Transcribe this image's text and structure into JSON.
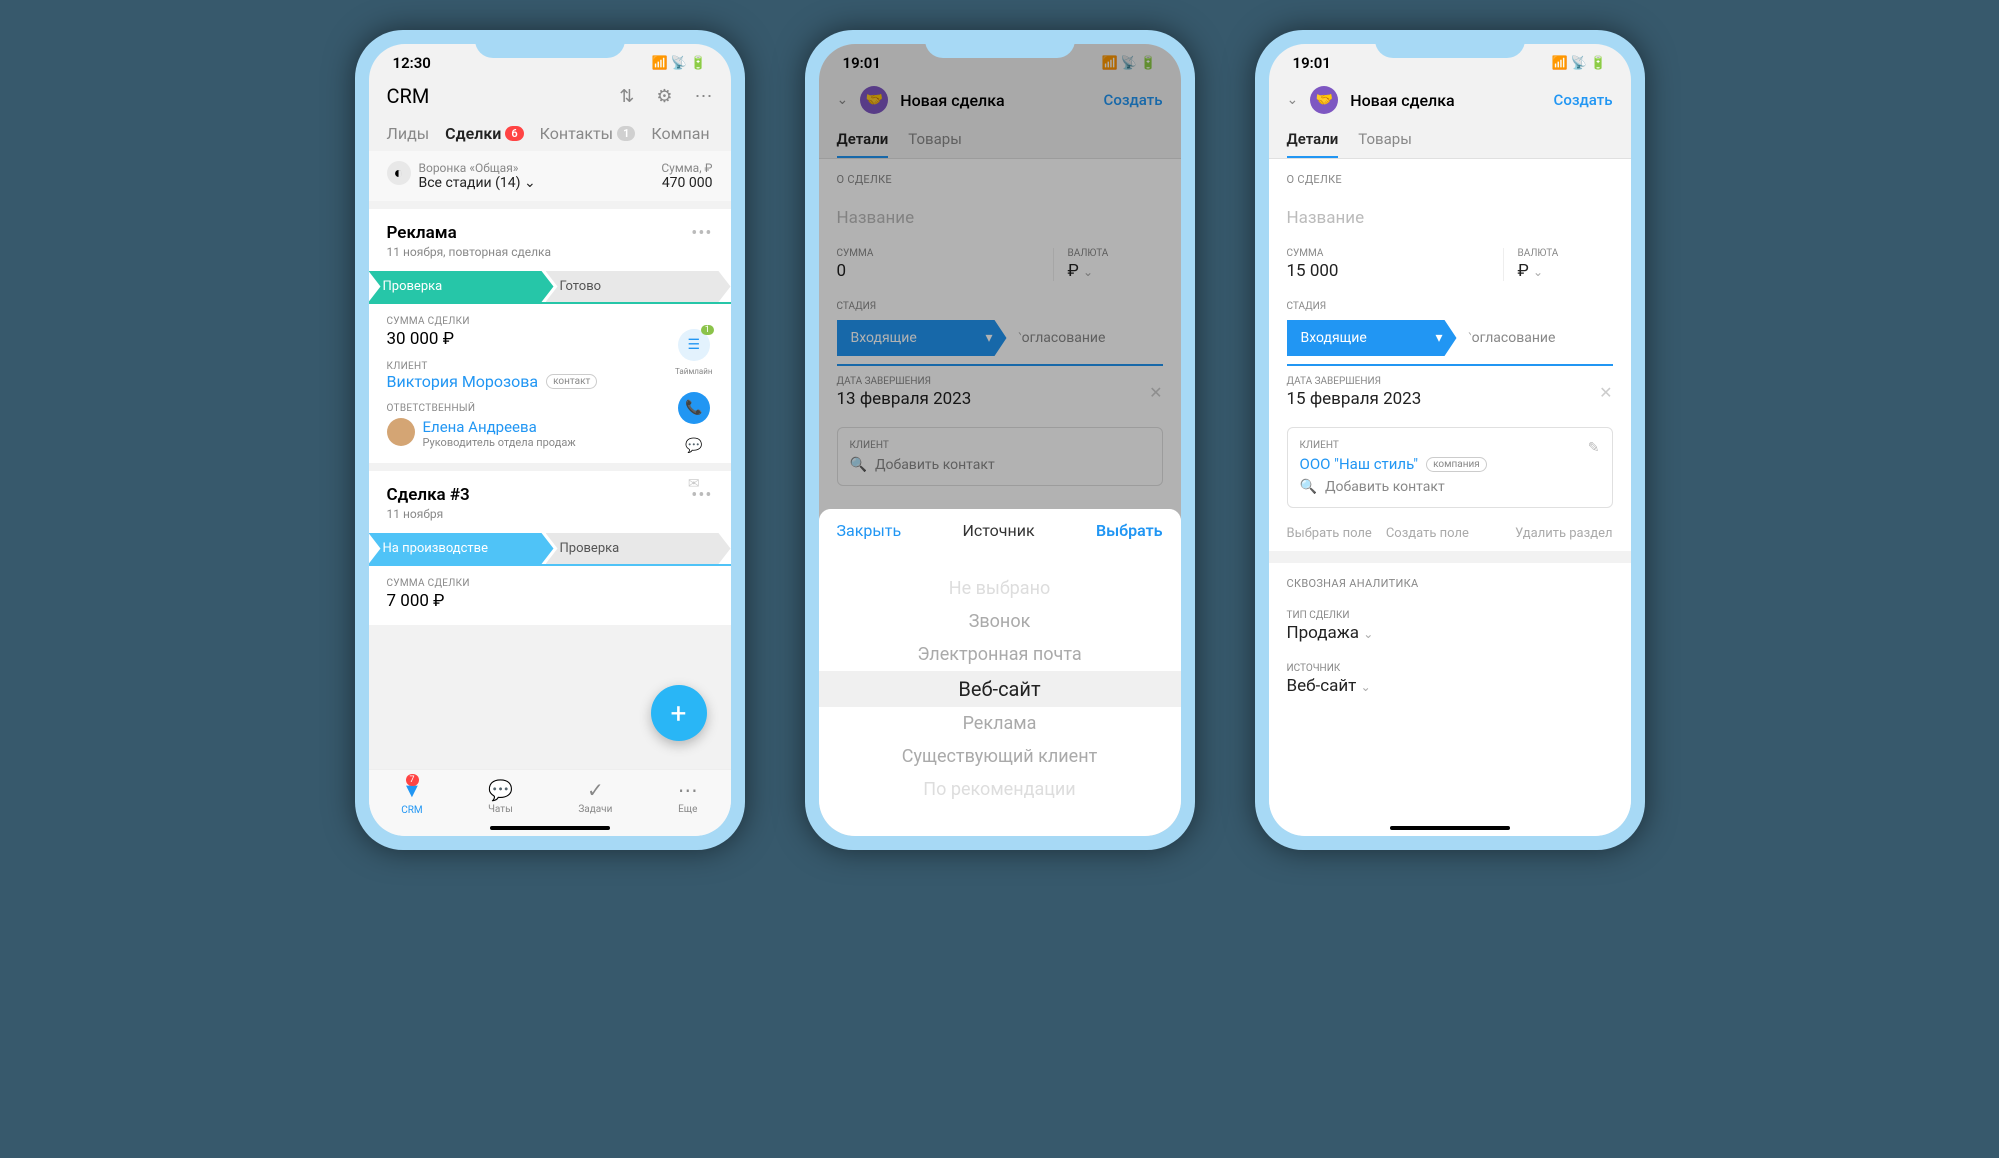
{
  "phone1": {
    "time": "12:30",
    "signal": "••l",
    "app_title": "CRM",
    "tabs": {
      "leads": "Лиды",
      "deals": "Сделки",
      "deals_badge": "6",
      "contacts": "Контакты",
      "contacts_badge": "1",
      "companies": "Компан"
    },
    "funnel": {
      "label": "Воронка «Общая»",
      "stage": "Все стадии (14)",
      "sum_label": "Сумма, ₽",
      "sum_value": "470 000"
    },
    "card1": {
      "title": "Реклама",
      "sub": "11 ноября, повторная сделка",
      "stage_active": "Проверка",
      "stage_next": "Готово",
      "stage_color": "#26c6a8",
      "sum_label": "СУММА СДЕЛКИ",
      "sum": "30 000 ₽",
      "client_label": "КЛИЕНТ",
      "client": "Виктория Морозова",
      "client_badge": "контакт",
      "resp_label": "ОТВЕТСТВЕННЫЙ",
      "resp_name": "Елена Андреева",
      "resp_role": "Руководитель отдела продаж",
      "timeline_label": "Таймлайн",
      "timeline_badge": "1"
    },
    "card2": {
      "title": "Сделка #3",
      "sub": "11 ноября",
      "stage_active": "На производстве",
      "stage_next": "Проверка",
      "stage_color": "#4fc3f7",
      "sum_label": "СУММА СДЕЛКИ",
      "sum": "7 000 ₽"
    },
    "nav": {
      "crm": "CRM",
      "crm_badge": "7",
      "chats": "Чаты",
      "tasks": "Задачи",
      "more": "Еще"
    }
  },
  "phone2": {
    "time": "19:01",
    "header_title": "Новая сделка",
    "create": "Создать",
    "tabs": {
      "details": "Детали",
      "goods": "Товары"
    },
    "section_about": "О СДЕЛКЕ",
    "name_placeholder": "Название",
    "sum_label": "СУММА",
    "sum_value": "0",
    "currency_label": "ВАЛЮТА",
    "currency_value": "₽",
    "stage_label": "СТАДИЯ",
    "stage_active": "Входящие",
    "stage_next": "Согласование",
    "date_label": "ДАТА ЗАВЕРШЕНИЯ",
    "date_value": "13 февраля 2023",
    "client_label": "КЛИЕНТ",
    "add_contact": "Добавить контакт",
    "picker": {
      "close": "Закрыть",
      "title": "Источник",
      "select": "Выбрать",
      "items": [
        "Не выбрано",
        "Звонок",
        "Электронная почта",
        "Веб-сайт",
        "Реклама",
        "Существующий клиент",
        "По рекомендации"
      ],
      "selected_index": 3
    }
  },
  "phone3": {
    "time": "19:01",
    "header_title": "Новая сделка",
    "create": "Создать",
    "tabs": {
      "details": "Детали",
      "goods": "Товары"
    },
    "section_about": "О СДЕЛКЕ",
    "name_placeholder": "Название",
    "sum_label": "СУММА",
    "sum_value": "15 000",
    "currency_label": "ВАЛЮТА",
    "currency_value": "₽",
    "stage_label": "СТАДИЯ",
    "stage_active": "Входящие",
    "stage_next": "Согласование",
    "date_label": "ДАТА ЗАВЕРШЕНИЯ",
    "date_value": "15 февраля 2023",
    "client_label": "КЛИЕНТ",
    "client_company": "ООО \"Наш стиль\"",
    "company_badge": "компания",
    "add_contact": "Добавить контакт",
    "actions": {
      "select_field": "Выбрать поле",
      "create_field": "Создать поле",
      "delete_section": "Удалить раздел"
    },
    "section_analytics": "СКВОЗНАЯ АНАЛИТИКА",
    "deal_type_label": "ТИП СДЕЛКИ",
    "deal_type_value": "Продажа",
    "source_label": "ИСТОЧНИК",
    "source_value": "Веб-сайт"
  }
}
